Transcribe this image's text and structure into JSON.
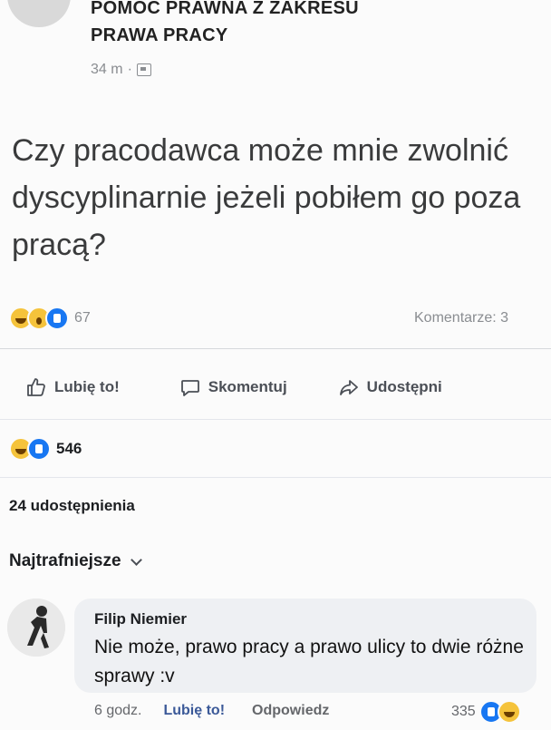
{
  "post": {
    "group_name_line1": "POMOC PRAWNA Z ZAKRESU",
    "group_name_line2": "PRAWA PRACY",
    "time": "34 m",
    "time_separator": "·",
    "text": "Czy pracodawca może mnie zwolnić dyscyplinarnie jeżeli pobiłem go poza pracą?",
    "reactions_count": "67",
    "comments_count": "Komentarze: 3"
  },
  "actions": {
    "like": "Lubię to!",
    "comment": "Skomentuj",
    "share": "Udostępni"
  },
  "stats": {
    "reactions_count": "546",
    "shares": "24 udostępnienia"
  },
  "comments_section": {
    "sort_label": "Najtrafniejsze"
  },
  "comment": {
    "author": "Filip Niemier",
    "text": "Nie może, prawo pracy a prawo ulicy to dwie różne sprawy :v",
    "time": "6 godz.",
    "like": "Lubię to!",
    "reply": "Odpowiedz",
    "reactions_count": "335"
  },
  "colors": {
    "like_blue": "#1877f2",
    "emoji_yellow": "#f5c33b",
    "muted_text": "#8a8d91"
  }
}
